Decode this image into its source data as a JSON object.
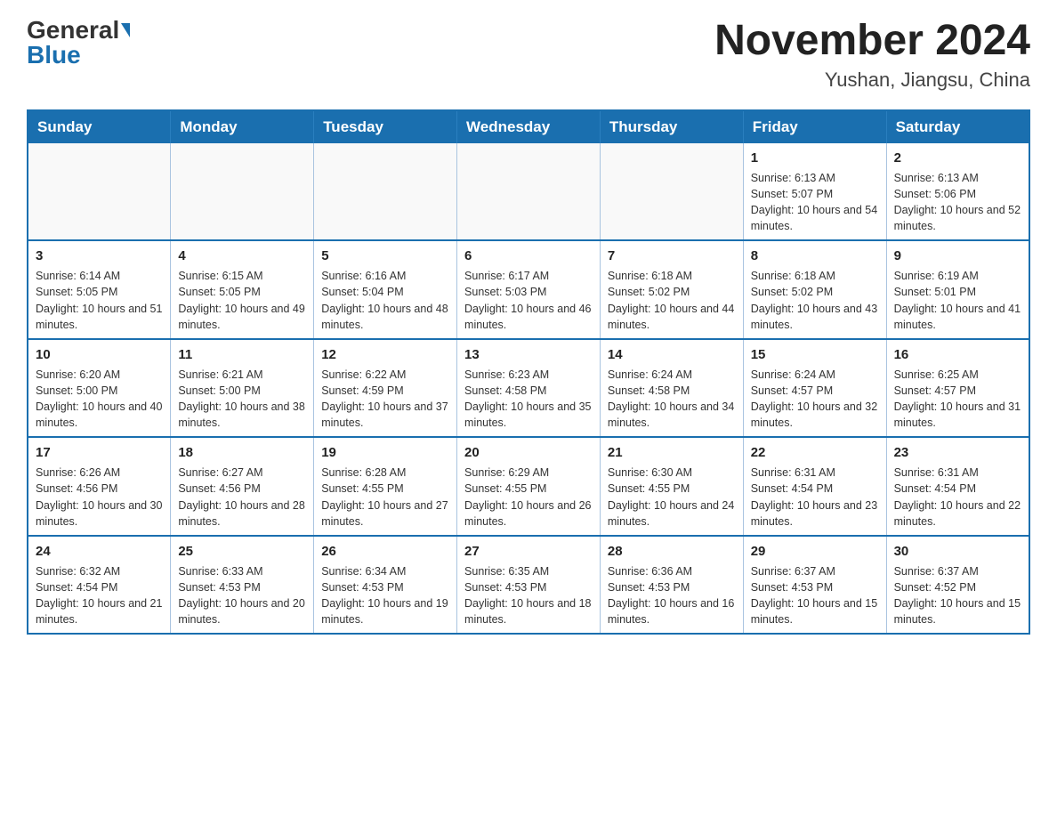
{
  "logo": {
    "general": "General",
    "blue": "Blue"
  },
  "title": "November 2024",
  "subtitle": "Yushan, Jiangsu, China",
  "days_of_week": [
    "Sunday",
    "Monday",
    "Tuesday",
    "Wednesday",
    "Thursday",
    "Friday",
    "Saturday"
  ],
  "weeks": [
    [
      {
        "day": "",
        "info": ""
      },
      {
        "day": "",
        "info": ""
      },
      {
        "day": "",
        "info": ""
      },
      {
        "day": "",
        "info": ""
      },
      {
        "day": "",
        "info": ""
      },
      {
        "day": "1",
        "info": "Sunrise: 6:13 AM\nSunset: 5:07 PM\nDaylight: 10 hours and 54 minutes."
      },
      {
        "day": "2",
        "info": "Sunrise: 6:13 AM\nSunset: 5:06 PM\nDaylight: 10 hours and 52 minutes."
      }
    ],
    [
      {
        "day": "3",
        "info": "Sunrise: 6:14 AM\nSunset: 5:05 PM\nDaylight: 10 hours and 51 minutes."
      },
      {
        "day": "4",
        "info": "Sunrise: 6:15 AM\nSunset: 5:05 PM\nDaylight: 10 hours and 49 minutes."
      },
      {
        "day": "5",
        "info": "Sunrise: 6:16 AM\nSunset: 5:04 PM\nDaylight: 10 hours and 48 minutes."
      },
      {
        "day": "6",
        "info": "Sunrise: 6:17 AM\nSunset: 5:03 PM\nDaylight: 10 hours and 46 minutes."
      },
      {
        "day": "7",
        "info": "Sunrise: 6:18 AM\nSunset: 5:02 PM\nDaylight: 10 hours and 44 minutes."
      },
      {
        "day": "8",
        "info": "Sunrise: 6:18 AM\nSunset: 5:02 PM\nDaylight: 10 hours and 43 minutes."
      },
      {
        "day": "9",
        "info": "Sunrise: 6:19 AM\nSunset: 5:01 PM\nDaylight: 10 hours and 41 minutes."
      }
    ],
    [
      {
        "day": "10",
        "info": "Sunrise: 6:20 AM\nSunset: 5:00 PM\nDaylight: 10 hours and 40 minutes."
      },
      {
        "day": "11",
        "info": "Sunrise: 6:21 AM\nSunset: 5:00 PM\nDaylight: 10 hours and 38 minutes."
      },
      {
        "day": "12",
        "info": "Sunrise: 6:22 AM\nSunset: 4:59 PM\nDaylight: 10 hours and 37 minutes."
      },
      {
        "day": "13",
        "info": "Sunrise: 6:23 AM\nSunset: 4:58 PM\nDaylight: 10 hours and 35 minutes."
      },
      {
        "day": "14",
        "info": "Sunrise: 6:24 AM\nSunset: 4:58 PM\nDaylight: 10 hours and 34 minutes."
      },
      {
        "day": "15",
        "info": "Sunrise: 6:24 AM\nSunset: 4:57 PM\nDaylight: 10 hours and 32 minutes."
      },
      {
        "day": "16",
        "info": "Sunrise: 6:25 AM\nSunset: 4:57 PM\nDaylight: 10 hours and 31 minutes."
      }
    ],
    [
      {
        "day": "17",
        "info": "Sunrise: 6:26 AM\nSunset: 4:56 PM\nDaylight: 10 hours and 30 minutes."
      },
      {
        "day": "18",
        "info": "Sunrise: 6:27 AM\nSunset: 4:56 PM\nDaylight: 10 hours and 28 minutes."
      },
      {
        "day": "19",
        "info": "Sunrise: 6:28 AM\nSunset: 4:55 PM\nDaylight: 10 hours and 27 minutes."
      },
      {
        "day": "20",
        "info": "Sunrise: 6:29 AM\nSunset: 4:55 PM\nDaylight: 10 hours and 26 minutes."
      },
      {
        "day": "21",
        "info": "Sunrise: 6:30 AM\nSunset: 4:55 PM\nDaylight: 10 hours and 24 minutes."
      },
      {
        "day": "22",
        "info": "Sunrise: 6:31 AM\nSunset: 4:54 PM\nDaylight: 10 hours and 23 minutes."
      },
      {
        "day": "23",
        "info": "Sunrise: 6:31 AM\nSunset: 4:54 PM\nDaylight: 10 hours and 22 minutes."
      }
    ],
    [
      {
        "day": "24",
        "info": "Sunrise: 6:32 AM\nSunset: 4:54 PM\nDaylight: 10 hours and 21 minutes."
      },
      {
        "day": "25",
        "info": "Sunrise: 6:33 AM\nSunset: 4:53 PM\nDaylight: 10 hours and 20 minutes."
      },
      {
        "day": "26",
        "info": "Sunrise: 6:34 AM\nSunset: 4:53 PM\nDaylight: 10 hours and 19 minutes."
      },
      {
        "day": "27",
        "info": "Sunrise: 6:35 AM\nSunset: 4:53 PM\nDaylight: 10 hours and 18 minutes."
      },
      {
        "day": "28",
        "info": "Sunrise: 6:36 AM\nSunset: 4:53 PM\nDaylight: 10 hours and 16 minutes."
      },
      {
        "day": "29",
        "info": "Sunrise: 6:37 AM\nSunset: 4:53 PM\nDaylight: 10 hours and 15 minutes."
      },
      {
        "day": "30",
        "info": "Sunrise: 6:37 AM\nSunset: 4:52 PM\nDaylight: 10 hours and 15 minutes."
      }
    ]
  ]
}
